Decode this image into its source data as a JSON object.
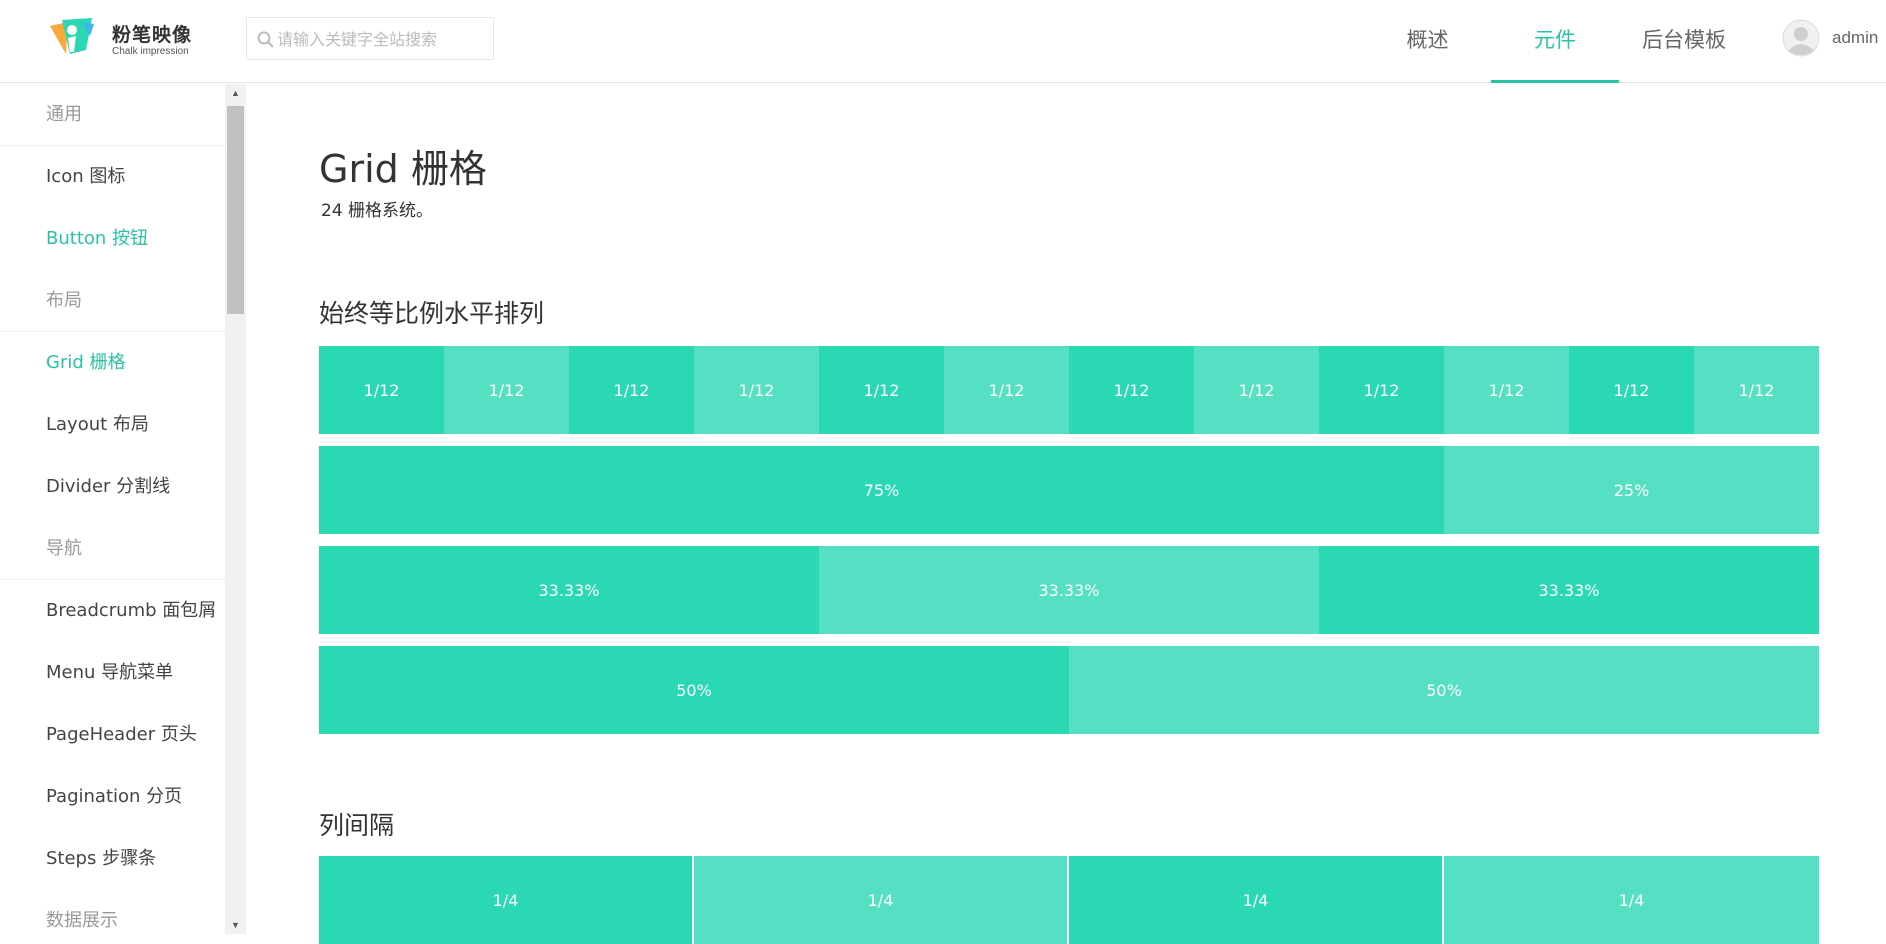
{
  "brand": {
    "title": "粉笔映像",
    "subtitle": "Chalk impression",
    "accent_color": "#2ac2a4",
    "logo_colors": [
      "#2ad8b3",
      "#f7a93b",
      "#3fb8e8"
    ]
  },
  "search": {
    "placeholder": "请输入关键字全站搜索",
    "value": "",
    "icon": "search-icon"
  },
  "nav": {
    "items": [
      {
        "label": "概述"
      },
      {
        "label": "元件"
      },
      {
        "label": "后台模板"
      }
    ],
    "active_index": 1
  },
  "user": {
    "name": "admin",
    "icon": "avatar-icon"
  },
  "sidebar": {
    "entries": [
      {
        "type": "category",
        "label": "通用"
      },
      {
        "type": "item",
        "label": "Icon 图标"
      },
      {
        "type": "item",
        "label": "Button 按钮"
      },
      {
        "type": "category",
        "label": "布局"
      },
      {
        "type": "item",
        "label": "Grid 栅格"
      },
      {
        "type": "item",
        "label": "Layout 布局"
      },
      {
        "type": "item",
        "label": "Divider 分割线"
      },
      {
        "type": "category",
        "label": "导航"
      },
      {
        "type": "item",
        "label": "Breadcrumb 面包屑"
      },
      {
        "type": "item",
        "label": "Menu 导航菜单"
      },
      {
        "type": "item",
        "label": "PageHeader 页头"
      },
      {
        "type": "item",
        "label": "Pagination 分页"
      },
      {
        "type": "item",
        "label": "Steps 步骤条"
      },
      {
        "type": "category",
        "label": "数据展示"
      }
    ],
    "highlighted": [
      "Button 按钮",
      "Grid 栅格"
    ]
  },
  "main": {
    "title": "Grid 栅格",
    "description": "24 栅格系统。",
    "sections": [
      {
        "title": "始终等比例水平排列",
        "rows": [
          {
            "cells": [
              "1/12",
              "1/12",
              "1/12",
              "1/12",
              "1/12",
              "1/12",
              "1/12",
              "1/12",
              "1/12",
              "1/12",
              "1/12",
              "1/12"
            ],
            "spans": [
              2,
              2,
              2,
              2,
              2,
              2,
              2,
              2,
              2,
              2,
              2,
              2
            ]
          },
          {
            "cells": [
              "75%",
              "25%"
            ],
            "spans": [
              18,
              6
            ]
          },
          {
            "cells": [
              "33.33%",
              "33.33%",
              "33.33%"
            ],
            "spans": [
              8,
              8,
              8
            ]
          },
          {
            "cells": [
              "50%",
              "50%"
            ],
            "spans": [
              12,
              12
            ]
          }
        ]
      },
      {
        "title": "列间隔",
        "rows": [
          {
            "cells": [
              "1/4",
              "1/4",
              "1/4",
              "1/4"
            ],
            "spans": [
              6,
              6,
              6,
              6
            ]
          }
        ]
      }
    ],
    "colors": {
      "dark": "#2ad8b3",
      "light": "#55e0c3"
    }
  }
}
